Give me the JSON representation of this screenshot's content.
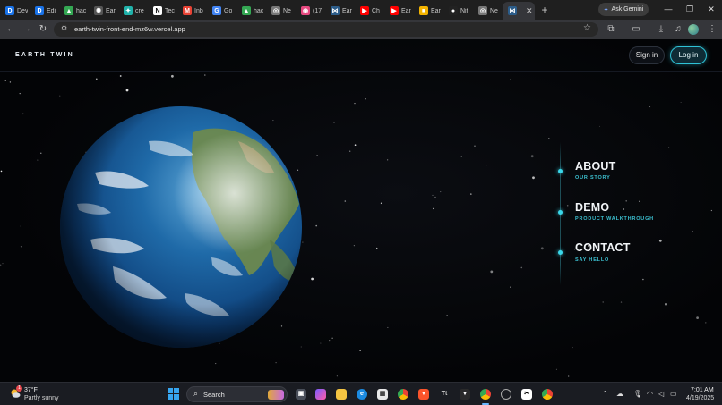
{
  "browser": {
    "tabs": [
      {
        "title": "Dev",
        "icon": "d-logo-icon",
        "color": "#1a73e8",
        "glyph": "D"
      },
      {
        "title": "Edi",
        "icon": "d-logo-icon",
        "color": "#1a73e8",
        "glyph": "D"
      },
      {
        "title": "hac",
        "icon": "drive-icon",
        "color": "#34a853",
        "glyph": "▲"
      },
      {
        "title": "Ear",
        "icon": "openai-icon",
        "color": "#555555",
        "glyph": "✺"
      },
      {
        "title": "cre",
        "icon": "sparkle-icon",
        "color": "#20b2aa",
        "glyph": "✦"
      },
      {
        "title": "Tec",
        "icon": "notion-icon",
        "color": "#ffffff",
        "glyph": "N"
      },
      {
        "title": "Inb",
        "icon": "gmail-icon",
        "color": "#ea4335",
        "glyph": "M"
      },
      {
        "title": "Go",
        "icon": "google-icon",
        "color": "#4285f4",
        "glyph": "G"
      },
      {
        "title": "hac",
        "icon": "drive-icon",
        "color": "#34a853",
        "glyph": "▲"
      },
      {
        "title": "Ne",
        "icon": "chrome-gray-icon",
        "color": "#777777",
        "glyph": "◎"
      },
      {
        "title": "(17",
        "icon": "discord-icon",
        "color": "#e64980",
        "glyph": "◉"
      },
      {
        "title": "Ear",
        "icon": "vercel-tab-icon",
        "color": "#2c5d8a",
        "glyph": "⋈"
      },
      {
        "title": "Ch",
        "icon": "youtube-icon",
        "color": "#ff0000",
        "glyph": "▶"
      },
      {
        "title": "Ear",
        "icon": "youtube-icon",
        "color": "#ff0000",
        "glyph": "▶"
      },
      {
        "title": "Ear",
        "icon": "slides-icon",
        "color": "#f4b400",
        "glyph": "■"
      },
      {
        "title": "Nit",
        "icon": "github-icon",
        "color": "#222222",
        "glyph": "●"
      },
      {
        "title": "Ne",
        "icon": "chrome-gray-icon",
        "color": "#777777",
        "glyph": "◎"
      },
      {
        "title": "",
        "icon": "vercel-tab-icon",
        "color": "#2c5d8a",
        "glyph": "⋈",
        "active": true
      }
    ],
    "new_tab": "+",
    "ask_gemini": "Ask Gemini",
    "url": "earth-twin-front-end-mz6w.vercel.app"
  },
  "site": {
    "brand": "EARTH TWIN",
    "sign_in": "Sign in",
    "log_in": "Log in",
    "accent_color": "#3ad7ea",
    "nav": [
      {
        "title": "ABOUT",
        "sub": "OUR STORY"
      },
      {
        "title": "DEMO",
        "sub": "PRODUCT WALKTHROUGH"
      },
      {
        "title": "CONTACT",
        "sub": "SAY HELLO"
      }
    ]
  },
  "taskbar": {
    "weather_temp": "37°F",
    "weather_desc": "Partly sunny",
    "weather_badge": "1",
    "search": "Search",
    "time": "7:01 AM",
    "date": "4/19/2025"
  }
}
